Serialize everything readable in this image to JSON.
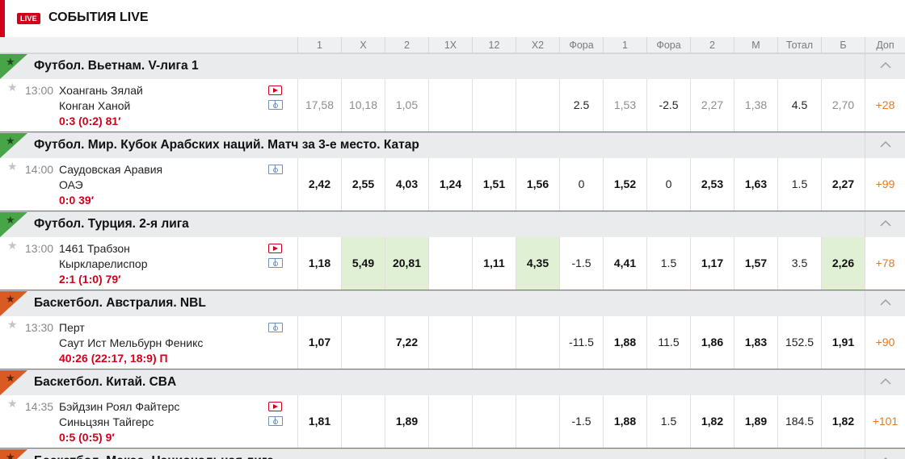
{
  "header": {
    "live_badge": "LIVE",
    "title": "СОБЫТИЯ LIVE"
  },
  "columns": [
    "1",
    "X",
    "2",
    "1X",
    "12",
    "X2",
    "Фора",
    "1",
    "Фора",
    "2",
    "М",
    "Тотал",
    "Б",
    "Доп"
  ],
  "colors": {
    "football": "#47a447",
    "basketball": "#d95a23",
    "live_red": "#d0021b",
    "highlight": "#dff0d4",
    "more": "#e07a1f"
  },
  "leagues": [
    {
      "name": "Футбол. Вьетнам. V-лига 1",
      "sport": "football",
      "match": {
        "time": "13:00",
        "team1": "Хоангань Зялай",
        "team2": "Конган Ханой",
        "score": "0:3 (0:2) 81′",
        "icons": [
          "video-icon",
          "field-icon"
        ],
        "odds": [
          {
            "v": "17,58",
            "s": "muted"
          },
          {
            "v": "10,18",
            "s": "muted"
          },
          {
            "v": "1,05",
            "s": "muted"
          },
          {
            "v": "",
            "s": "muted"
          },
          {
            "v": "",
            "s": "muted"
          },
          {
            "v": "",
            "s": "muted"
          },
          {
            "v": "2.5",
            "s": "plain"
          },
          {
            "v": "1,53",
            "s": "muted"
          },
          {
            "v": "-2.5",
            "s": "plain"
          },
          {
            "v": "2,27",
            "s": "muted"
          },
          {
            "v": "1,38",
            "s": "muted"
          },
          {
            "v": "4.5",
            "s": "plain"
          },
          {
            "v": "2,70",
            "s": "muted"
          },
          {
            "v": "+28",
            "s": "more"
          }
        ]
      }
    },
    {
      "name": "Футбол. Мир. Кубок Арабских наций. Матч за 3-е место. Катар",
      "sport": "football",
      "match": {
        "time": "14:00",
        "team1": "Саудовская Аравия",
        "team2": "ОАЭ",
        "score": "0:0 39′",
        "icons": [
          "field-icon"
        ],
        "odds": [
          {
            "v": "2,42",
            "s": "bold"
          },
          {
            "v": "2,55",
            "s": "bold"
          },
          {
            "v": "4,03",
            "s": "bold"
          },
          {
            "v": "1,24",
            "s": "bold"
          },
          {
            "v": "1,51",
            "s": "bold"
          },
          {
            "v": "1,56",
            "s": "bold"
          },
          {
            "v": "0",
            "s": "plain"
          },
          {
            "v": "1,52",
            "s": "bold"
          },
          {
            "v": "0",
            "s": "plain"
          },
          {
            "v": "2,53",
            "s": "bold"
          },
          {
            "v": "1,63",
            "s": "bold"
          },
          {
            "v": "1.5",
            "s": "plain"
          },
          {
            "v": "2,27",
            "s": "bold"
          },
          {
            "v": "+99",
            "s": "more"
          }
        ]
      }
    },
    {
      "name": "Футбол. Турция. 2-я лига",
      "sport": "football",
      "match": {
        "time": "13:00",
        "team1": "1461 Трабзон",
        "team2": "Кыркларелиспор",
        "score": "2:1 (1:0) 79′",
        "icons": [
          "video-icon",
          "field-icon"
        ],
        "odds": [
          {
            "v": "1,18",
            "s": "bold"
          },
          {
            "v": "5,49",
            "s": "bold hl"
          },
          {
            "v": "20,81",
            "s": "bold hl"
          },
          {
            "v": "",
            "s": "plain"
          },
          {
            "v": "1,11",
            "s": "bold"
          },
          {
            "v": "4,35",
            "s": "bold hl"
          },
          {
            "v": "-1.5",
            "s": "plain"
          },
          {
            "v": "4,41",
            "s": "bold"
          },
          {
            "v": "1.5",
            "s": "plain"
          },
          {
            "v": "1,17",
            "s": "bold"
          },
          {
            "v": "1,57",
            "s": "bold"
          },
          {
            "v": "3.5",
            "s": "plain"
          },
          {
            "v": "2,26",
            "s": "bold hl"
          },
          {
            "v": "+78",
            "s": "more"
          }
        ]
      }
    },
    {
      "name": "Баскетбол. Австралия. NBL",
      "sport": "basketball",
      "match": {
        "time": "13:30",
        "team1": "Перт",
        "team2": "Саут Ист Мельбурн Феникс",
        "score": "40:26 (22:17, 18:9) П",
        "icons": [
          "field-icon"
        ],
        "odds": [
          {
            "v": "1,07",
            "s": "bold"
          },
          {
            "v": "",
            "s": "plain"
          },
          {
            "v": "7,22",
            "s": "bold"
          },
          {
            "v": "",
            "s": "plain"
          },
          {
            "v": "",
            "s": "plain"
          },
          {
            "v": "",
            "s": "plain"
          },
          {
            "v": "-11.5",
            "s": "plain"
          },
          {
            "v": "1,88",
            "s": "bold"
          },
          {
            "v": "11.5",
            "s": "plain"
          },
          {
            "v": "1,86",
            "s": "bold"
          },
          {
            "v": "1,83",
            "s": "bold"
          },
          {
            "v": "152.5",
            "s": "plain"
          },
          {
            "v": "1,91",
            "s": "bold"
          },
          {
            "v": "+90",
            "s": "more"
          }
        ]
      }
    },
    {
      "name": "Баскетбол. Китай. CBA",
      "sport": "basketball",
      "match": {
        "time": "14:35",
        "team1": "Бэйдзин Роял Файтерс",
        "team2": "Синьцзян Тайгерс",
        "score": "0:5 (0:5) 9′",
        "icons": [
          "video-icon",
          "field-icon"
        ],
        "odds": [
          {
            "v": "1,81",
            "s": "bold"
          },
          {
            "v": "",
            "s": "plain"
          },
          {
            "v": "1,89",
            "s": "bold"
          },
          {
            "v": "",
            "s": "plain"
          },
          {
            "v": "",
            "s": "plain"
          },
          {
            "v": "",
            "s": "plain"
          },
          {
            "v": "-1.5",
            "s": "plain"
          },
          {
            "v": "1,88",
            "s": "bold"
          },
          {
            "v": "1.5",
            "s": "plain"
          },
          {
            "v": "1,82",
            "s": "bold"
          },
          {
            "v": "1,89",
            "s": "bold"
          },
          {
            "v": "184.5",
            "s": "plain"
          },
          {
            "v": "1,82",
            "s": "bold"
          },
          {
            "v": "+101",
            "s": "more"
          }
        ]
      }
    },
    {
      "name": "Баскетбол. Макао. Национальная лига",
      "sport": "basketball",
      "match": null
    }
  ]
}
